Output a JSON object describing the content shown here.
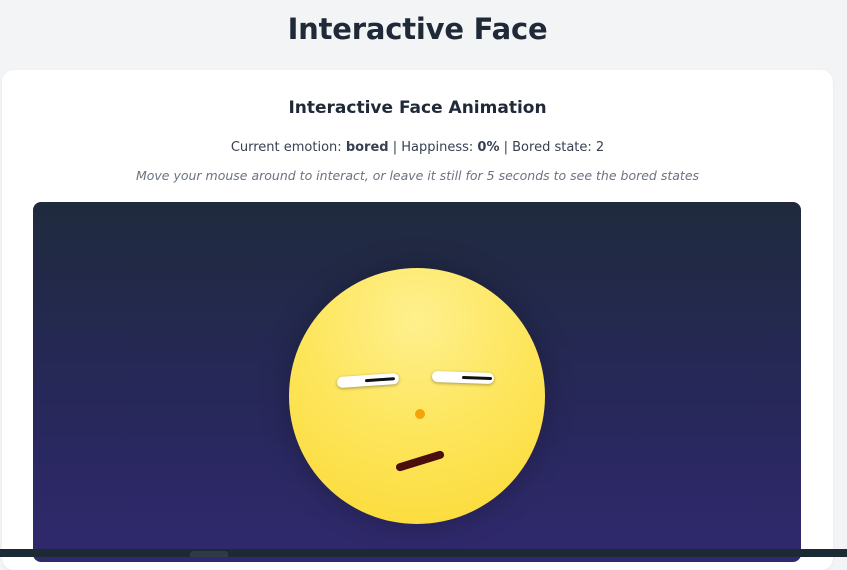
{
  "page": {
    "title": "Interactive Face"
  },
  "card": {
    "title": "Interactive Face Animation",
    "status": {
      "emotion_label": "Current emotion: ",
      "emotion_value": "bored",
      "separator_1": " | ",
      "happiness_label": "Happiness: ",
      "happiness_value": "0%",
      "separator_2": " | ",
      "bored_state_label": "Bored state: ",
      "bored_state_value": "2"
    },
    "hint": "Move your mouse around to interact, or leave it still for 5 seconds to see the bored states"
  },
  "face": {
    "emotion": "bored",
    "happiness": 0,
    "bored_state": 2,
    "colors": {
      "face": "#fde65e",
      "nose": "#f5a30a",
      "mouth": "#4a0e0e",
      "stage_top": "#1f2a3d",
      "stage_bottom": "#30296e"
    }
  }
}
